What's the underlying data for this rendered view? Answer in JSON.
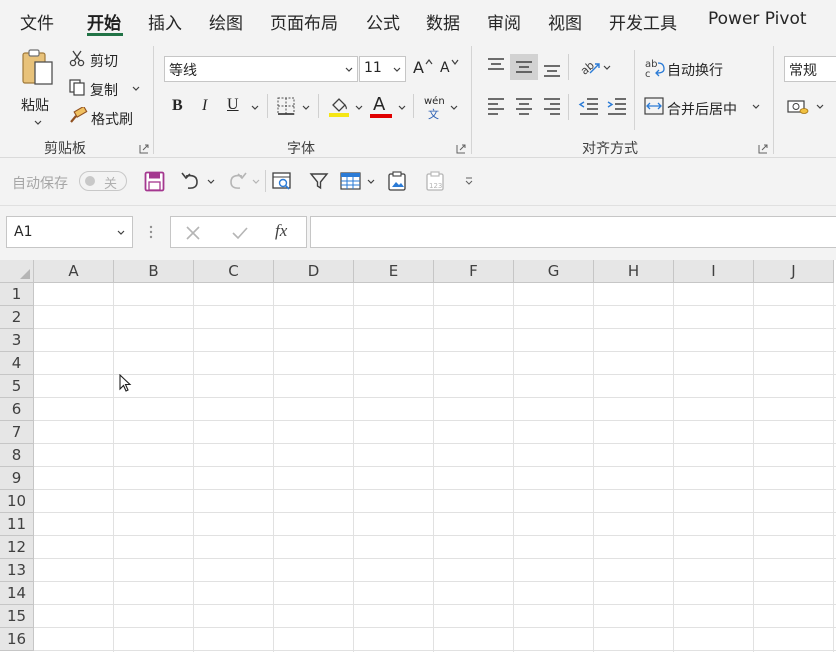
{
  "menu": {
    "tabs": [
      {
        "label": "文件"
      },
      {
        "label": "开始",
        "active": true
      },
      {
        "label": "插入"
      },
      {
        "label": "绘图"
      },
      {
        "label": "页面布局"
      },
      {
        "label": "公式"
      },
      {
        "label": "数据"
      },
      {
        "label": "审阅"
      },
      {
        "label": "视图"
      },
      {
        "label": "开发工具"
      },
      {
        "label": "Power Pivot"
      }
    ]
  },
  "ribbon": {
    "clipboard": {
      "paste_label": "粘贴",
      "cut_label": "剪切",
      "copy_label": "复制",
      "format_painter_label": "格式刷",
      "group_label": "剪贴板"
    },
    "font": {
      "font_name": "等线",
      "font_size": "11",
      "bold": "B",
      "italic": "I",
      "underline": "U",
      "font_color_glyph": "A",
      "increase_glyph": "A",
      "decrease_glyph": "A",
      "phonetic_top": "wén",
      "phonetic_bottom": "文",
      "group_label": "字体",
      "highlight_color": "#f5e614",
      "font_color": "#e00000"
    },
    "alignment": {
      "wrap_text_label": "自动换行",
      "merge_center_label": "合并后居中",
      "group_label": "对齐方式"
    },
    "number": {
      "format_value": "常规"
    }
  },
  "qat": {
    "autosave_label": "自动保存",
    "autosave_state": "关"
  },
  "formula_bar": {
    "name_box": "A1",
    "fx": "fx"
  },
  "grid": {
    "columns": [
      "A",
      "B",
      "C",
      "D",
      "E",
      "F",
      "G",
      "H",
      "I",
      "J"
    ],
    "rows": [
      "1",
      "2",
      "3",
      "4",
      "5",
      "6",
      "7",
      "8",
      "9",
      "10",
      "11",
      "12",
      "13",
      "14",
      "15",
      "16"
    ]
  },
  "colors": {
    "accent": "#217346",
    "save_icon": "#a4378f"
  }
}
